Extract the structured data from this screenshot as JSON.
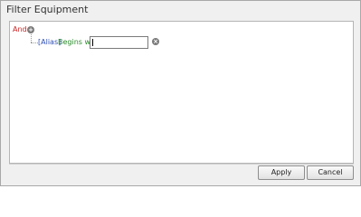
{
  "window": {
    "title": "Filter Equipment"
  },
  "filter": {
    "group_operator": "And",
    "add_icon": "plus-circle-icon",
    "condition": {
      "field": "[Alias]",
      "operator": "Begins with",
      "value": "",
      "remove_icon": "close-circle-icon"
    }
  },
  "buttons": {
    "apply": "Apply",
    "cancel": "Cancel"
  },
  "colors": {
    "operator_red": "#cc2222",
    "field_blue": "#2e4fb5",
    "op_green": "#2a8a2a"
  }
}
